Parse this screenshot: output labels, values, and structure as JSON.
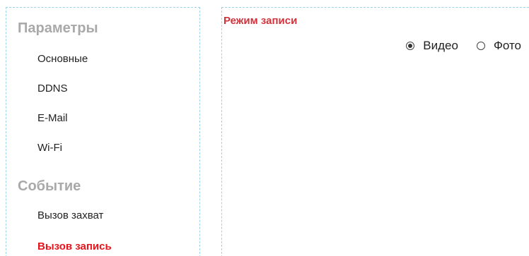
{
  "sidebar": {
    "groups": [
      {
        "title": "Параметры",
        "items": [
          {
            "label": "Основные",
            "active": false
          },
          {
            "label": "DDNS",
            "active": false
          },
          {
            "label": "E-Mail",
            "active": false
          },
          {
            "label": "Wi-Fi",
            "active": false
          }
        ]
      },
      {
        "title": "Событие",
        "items": [
          {
            "label": "Вызов захват",
            "active": false
          },
          {
            "label": "Вызов запись",
            "active": true
          }
        ]
      }
    ]
  },
  "main": {
    "section_title": "Режим записи",
    "record_mode": {
      "options": [
        {
          "label": "Видео",
          "selected": true
        },
        {
          "label": "Фото",
          "selected": false
        }
      ]
    }
  },
  "colors": {
    "active_item": "#e8141b",
    "section_title": "#d0333c",
    "group_title": "#a9a9a9",
    "dashed_border": "#9fd3ea"
  }
}
